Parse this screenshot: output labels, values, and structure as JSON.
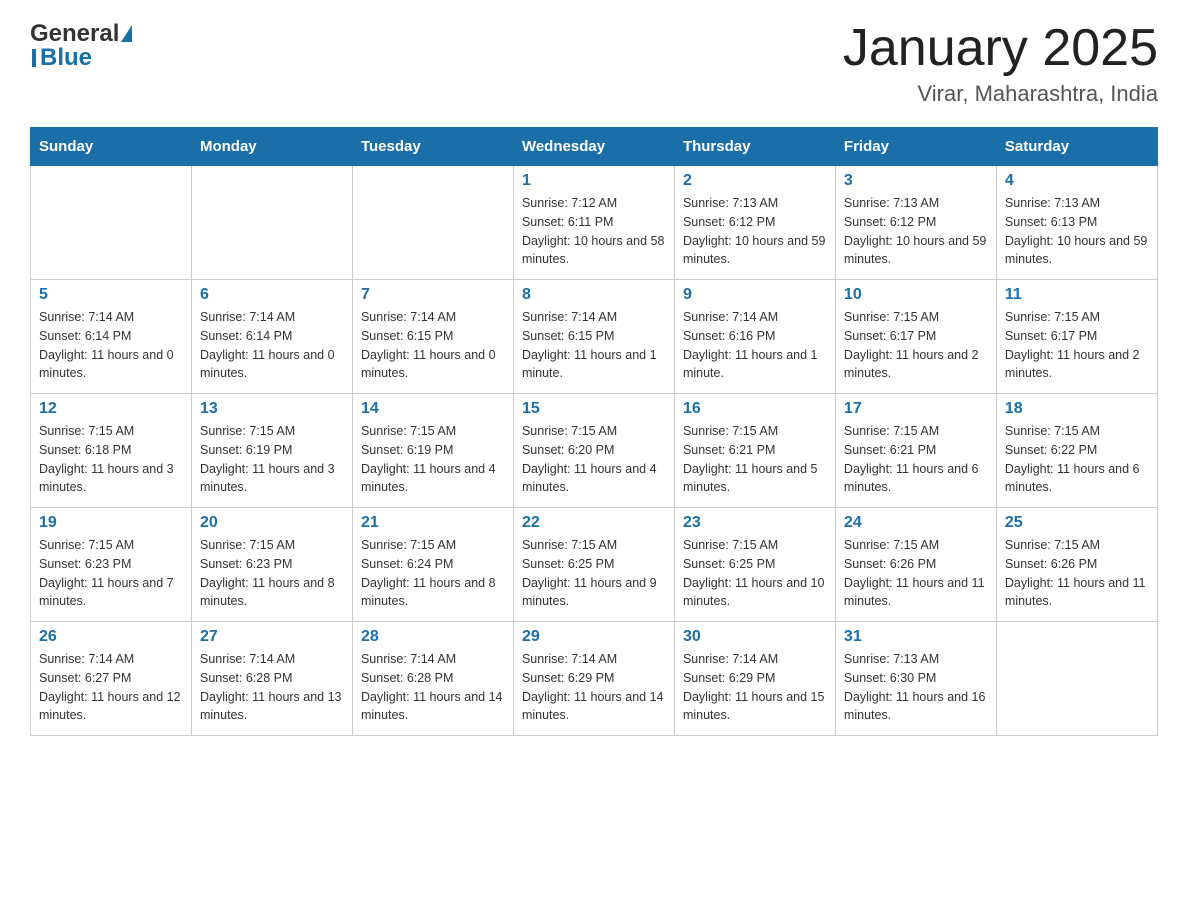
{
  "header": {
    "logo_general": "General",
    "logo_blue": "Blue",
    "month_title": "January 2025",
    "location": "Virar, Maharashtra, India"
  },
  "weekdays": [
    "Sunday",
    "Monday",
    "Tuesday",
    "Wednesday",
    "Thursday",
    "Friday",
    "Saturday"
  ],
  "weeks": [
    [
      {
        "day": "",
        "info": ""
      },
      {
        "day": "",
        "info": ""
      },
      {
        "day": "",
        "info": ""
      },
      {
        "day": "1",
        "info": "Sunrise: 7:12 AM\nSunset: 6:11 PM\nDaylight: 10 hours and 58 minutes."
      },
      {
        "day": "2",
        "info": "Sunrise: 7:13 AM\nSunset: 6:12 PM\nDaylight: 10 hours and 59 minutes."
      },
      {
        "day": "3",
        "info": "Sunrise: 7:13 AM\nSunset: 6:12 PM\nDaylight: 10 hours and 59 minutes."
      },
      {
        "day": "4",
        "info": "Sunrise: 7:13 AM\nSunset: 6:13 PM\nDaylight: 10 hours and 59 minutes."
      }
    ],
    [
      {
        "day": "5",
        "info": "Sunrise: 7:14 AM\nSunset: 6:14 PM\nDaylight: 11 hours and 0 minutes."
      },
      {
        "day": "6",
        "info": "Sunrise: 7:14 AM\nSunset: 6:14 PM\nDaylight: 11 hours and 0 minutes."
      },
      {
        "day": "7",
        "info": "Sunrise: 7:14 AM\nSunset: 6:15 PM\nDaylight: 11 hours and 0 minutes."
      },
      {
        "day": "8",
        "info": "Sunrise: 7:14 AM\nSunset: 6:15 PM\nDaylight: 11 hours and 1 minute."
      },
      {
        "day": "9",
        "info": "Sunrise: 7:14 AM\nSunset: 6:16 PM\nDaylight: 11 hours and 1 minute."
      },
      {
        "day": "10",
        "info": "Sunrise: 7:15 AM\nSunset: 6:17 PM\nDaylight: 11 hours and 2 minutes."
      },
      {
        "day": "11",
        "info": "Sunrise: 7:15 AM\nSunset: 6:17 PM\nDaylight: 11 hours and 2 minutes."
      }
    ],
    [
      {
        "day": "12",
        "info": "Sunrise: 7:15 AM\nSunset: 6:18 PM\nDaylight: 11 hours and 3 minutes."
      },
      {
        "day": "13",
        "info": "Sunrise: 7:15 AM\nSunset: 6:19 PM\nDaylight: 11 hours and 3 minutes."
      },
      {
        "day": "14",
        "info": "Sunrise: 7:15 AM\nSunset: 6:19 PM\nDaylight: 11 hours and 4 minutes."
      },
      {
        "day": "15",
        "info": "Sunrise: 7:15 AM\nSunset: 6:20 PM\nDaylight: 11 hours and 4 minutes."
      },
      {
        "day": "16",
        "info": "Sunrise: 7:15 AM\nSunset: 6:21 PM\nDaylight: 11 hours and 5 minutes."
      },
      {
        "day": "17",
        "info": "Sunrise: 7:15 AM\nSunset: 6:21 PM\nDaylight: 11 hours and 6 minutes."
      },
      {
        "day": "18",
        "info": "Sunrise: 7:15 AM\nSunset: 6:22 PM\nDaylight: 11 hours and 6 minutes."
      }
    ],
    [
      {
        "day": "19",
        "info": "Sunrise: 7:15 AM\nSunset: 6:23 PM\nDaylight: 11 hours and 7 minutes."
      },
      {
        "day": "20",
        "info": "Sunrise: 7:15 AM\nSunset: 6:23 PM\nDaylight: 11 hours and 8 minutes."
      },
      {
        "day": "21",
        "info": "Sunrise: 7:15 AM\nSunset: 6:24 PM\nDaylight: 11 hours and 8 minutes."
      },
      {
        "day": "22",
        "info": "Sunrise: 7:15 AM\nSunset: 6:25 PM\nDaylight: 11 hours and 9 minutes."
      },
      {
        "day": "23",
        "info": "Sunrise: 7:15 AM\nSunset: 6:25 PM\nDaylight: 11 hours and 10 minutes."
      },
      {
        "day": "24",
        "info": "Sunrise: 7:15 AM\nSunset: 6:26 PM\nDaylight: 11 hours and 11 minutes."
      },
      {
        "day": "25",
        "info": "Sunrise: 7:15 AM\nSunset: 6:26 PM\nDaylight: 11 hours and 11 minutes."
      }
    ],
    [
      {
        "day": "26",
        "info": "Sunrise: 7:14 AM\nSunset: 6:27 PM\nDaylight: 11 hours and 12 minutes."
      },
      {
        "day": "27",
        "info": "Sunrise: 7:14 AM\nSunset: 6:28 PM\nDaylight: 11 hours and 13 minutes."
      },
      {
        "day": "28",
        "info": "Sunrise: 7:14 AM\nSunset: 6:28 PM\nDaylight: 11 hours and 14 minutes."
      },
      {
        "day": "29",
        "info": "Sunrise: 7:14 AM\nSunset: 6:29 PM\nDaylight: 11 hours and 14 minutes."
      },
      {
        "day": "30",
        "info": "Sunrise: 7:14 AM\nSunset: 6:29 PM\nDaylight: 11 hours and 15 minutes."
      },
      {
        "day": "31",
        "info": "Sunrise: 7:13 AM\nSunset: 6:30 PM\nDaylight: 11 hours and 16 minutes."
      },
      {
        "day": "",
        "info": ""
      }
    ]
  ]
}
